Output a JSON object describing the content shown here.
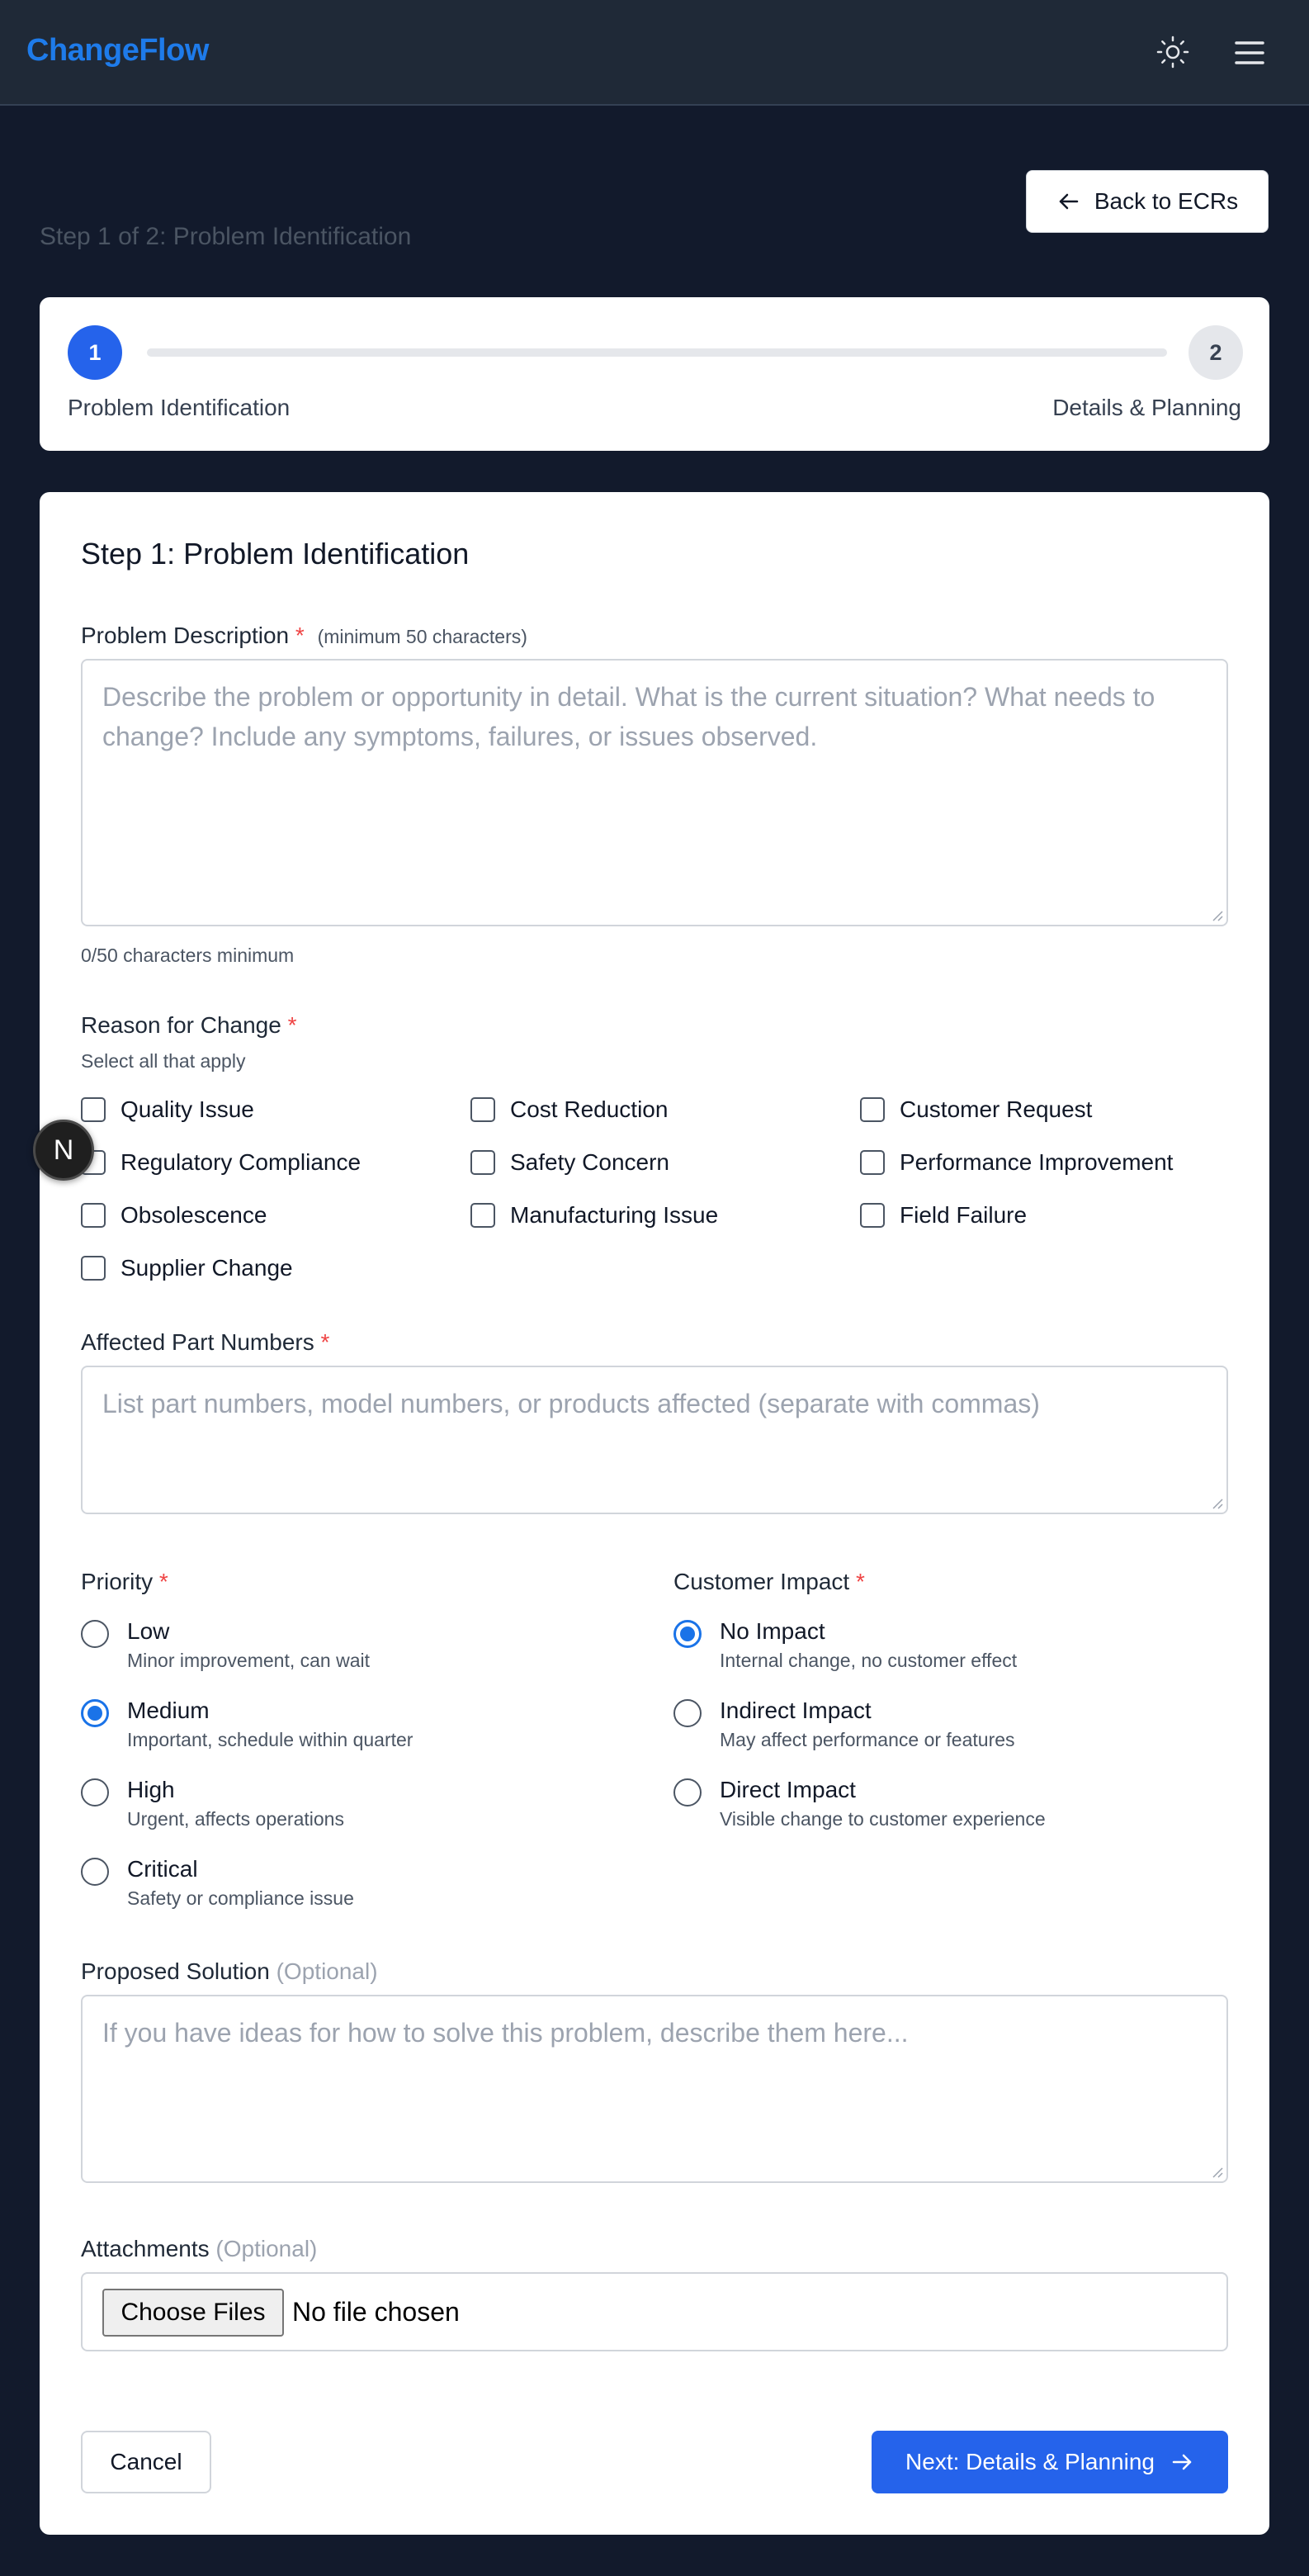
{
  "app": {
    "brand": "ChangeFlow"
  },
  "header": {
    "step_caption": "Step 1 of 2: Problem Identification",
    "back_label": "Back to ECRs"
  },
  "progress": {
    "steps": [
      {
        "number": "1",
        "label": "Problem Identification",
        "state": "active"
      },
      {
        "number": "2",
        "label": "Details & Planning",
        "state": "upcoming"
      }
    ]
  },
  "form": {
    "title": "Step 1: Problem Identification",
    "problem": {
      "label": "Problem Description",
      "required_mark": "*",
      "hint": "(minimum 50 characters)",
      "placeholder": "Describe the problem or opportunity in detail. What is the current situation? What needs to change? Include any symptoms, failures, or issues observed.",
      "value": "",
      "counter": "0/50 characters minimum"
    },
    "reason": {
      "label": "Reason for Change",
      "required_mark": "*",
      "hint": "Select all that apply",
      "options": [
        "Quality Issue",
        "Cost Reduction",
        "Customer Request",
        "Regulatory Compliance",
        "Safety Concern",
        "Performance Improvement",
        "Obsolescence",
        "Manufacturing Issue",
        "Field Failure",
        "Supplier Change"
      ]
    },
    "parts": {
      "label": "Affected Part Numbers",
      "required_mark": "*",
      "placeholder": "List part numbers, model numbers, or products affected (separate with commas)",
      "value": ""
    },
    "priority": {
      "label": "Priority",
      "required_mark": "*",
      "selected": "Medium",
      "options": [
        {
          "title": "Low",
          "desc": "Minor improvement, can wait"
        },
        {
          "title": "Medium",
          "desc": "Important, schedule within quarter"
        },
        {
          "title": "High",
          "desc": "Urgent, affects operations"
        },
        {
          "title": "Critical",
          "desc": "Safety or compliance issue"
        }
      ]
    },
    "impact": {
      "label": "Customer Impact",
      "required_mark": "*",
      "selected": "No Impact",
      "options": [
        {
          "title": "No Impact",
          "desc": "Internal change, no customer effect"
        },
        {
          "title": "Indirect Impact",
          "desc": "May affect performance or features"
        },
        {
          "title": "Direct Impact",
          "desc": "Visible change to customer experience"
        }
      ]
    },
    "solution": {
      "label": "Proposed Solution",
      "optional": "(Optional)",
      "placeholder": "If you have ideas for how to solve this problem, describe them here...",
      "value": ""
    },
    "attachments": {
      "label": "Attachments",
      "optional": "(Optional)",
      "choose_label": "Choose Files",
      "status": "No file chosen"
    },
    "actions": {
      "cancel_label": "Cancel",
      "next_label": "Next: Details & Planning"
    }
  },
  "overlay": {
    "badge_letter": "N"
  },
  "colors": {
    "accent": "#2563eb",
    "brand": "#1e7bea",
    "required": "#ef4444",
    "background": "#121a2c"
  }
}
